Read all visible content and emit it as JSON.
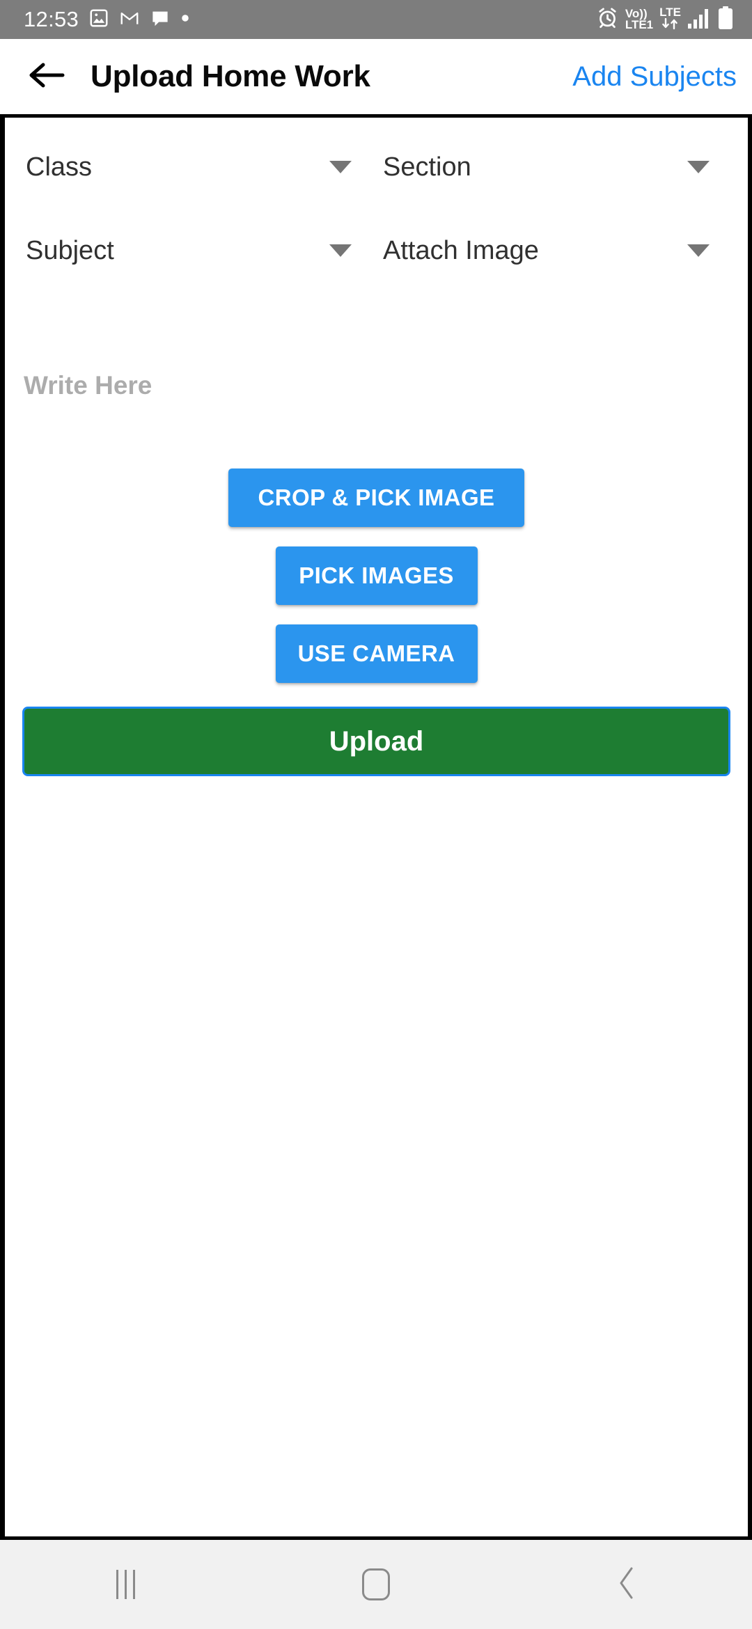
{
  "status_bar": {
    "clock": "12:53",
    "left_icons": [
      "photos-icon",
      "gmail-icon",
      "message-icon",
      "dot-icon"
    ],
    "right_icons": [
      "alarm-icon",
      "volte-icon",
      "lte-data-icon",
      "signal-icon",
      "battery-icon"
    ],
    "volte_top": "Vo))",
    "volte_bottom": "LTE1",
    "lte_label": "LTE",
    "background_color": "#7d7d7d",
    "foreground_color": "#ffffff"
  },
  "app_bar": {
    "back_icon": "arrow-left-icon",
    "title": "Upload Home Work",
    "action_label": "Add Subjects",
    "action_color": "#1a85f0"
  },
  "form": {
    "dropdowns": [
      {
        "label": "Class",
        "arrow": "chevron-down-icon"
      },
      {
        "label": "Section",
        "arrow": "chevron-down-icon"
      },
      {
        "label": "Subject",
        "arrow": "chevron-down-icon"
      },
      {
        "label": "Attach Image",
        "arrow": "chevron-down-icon"
      }
    ],
    "note_placeholder": "Write Here",
    "note_value": ""
  },
  "actions": {
    "crop_pick": "CROP & PICK IMAGE",
    "pick_images": "PICK IMAGES",
    "use_camera": "USE CAMERA",
    "upload": "Upload",
    "blue_color": "#2b95ee",
    "green_color": "#1e7d32",
    "upload_border_color": "#1a85f0"
  },
  "nav_bar": {
    "recents": "recents-icon",
    "home": "home-icon",
    "back": "back-chevron-icon",
    "background_color": "#f1f1f1",
    "icon_color": "#8a8a8a"
  }
}
